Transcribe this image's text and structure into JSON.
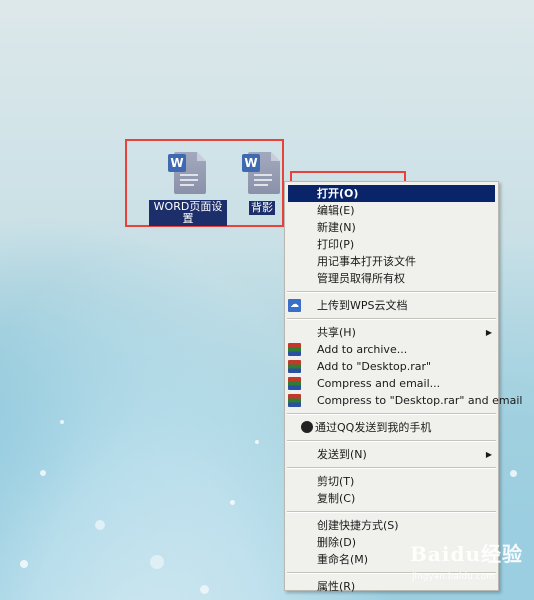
{
  "desktop": {
    "icons": [
      {
        "label": "WORD页面设置",
        "badge": "W"
      },
      {
        "label": "背影",
        "badge": "W"
      }
    ]
  },
  "context_menu": {
    "items": [
      {
        "label": "打开(O)",
        "selected": true
      },
      {
        "label": "编辑(E)"
      },
      {
        "label": "新建(N)"
      },
      {
        "label": "打印(P)"
      },
      {
        "label": "用记事本打开该文件"
      },
      {
        "label": "管理员取得所有权"
      },
      {
        "separator": true
      },
      {
        "label": "上传到WPS云文档",
        "icon": "wps-cloud-icon"
      },
      {
        "separator": true
      },
      {
        "label": "共享(H)",
        "submenu": true
      },
      {
        "label": "Add to archive...",
        "icon": "winrar-icon"
      },
      {
        "label": "Add to \"Desktop.rar\"",
        "icon": "winrar-icon"
      },
      {
        "label": "Compress and email...",
        "icon": "winrar-icon"
      },
      {
        "label": "Compress to \"Desktop.rar\" and email",
        "icon": "winrar-icon"
      },
      {
        "separator": true
      },
      {
        "label": "通过QQ发送到我的手机",
        "icon": "qq-icon"
      },
      {
        "separator": true
      },
      {
        "label": "发送到(N)",
        "submenu": true
      },
      {
        "separator": true
      },
      {
        "label": "剪切(T)"
      },
      {
        "label": "复制(C)"
      },
      {
        "separator": true
      },
      {
        "label": "创建快捷方式(S)"
      },
      {
        "label": "删除(D)"
      },
      {
        "label": "重命名(M)"
      },
      {
        "separator": true
      },
      {
        "label": "属性(R)"
      }
    ],
    "submenu_arrow": "▶"
  },
  "watermark": {
    "brand": "Baidu经验",
    "url": "jingyan.baidu.com"
  },
  "colors": {
    "highlight": "#0a246a",
    "annotation_red": "#e8423a",
    "menu_bg": "#f0f0ec"
  }
}
